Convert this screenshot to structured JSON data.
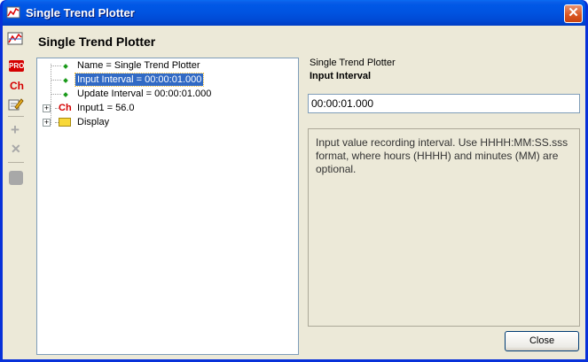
{
  "window": {
    "title": "Single Trend Plotter",
    "close_glyph": "✕"
  },
  "header": {
    "title": "Single Trend Plotter"
  },
  "toolbar": {
    "items": [
      {
        "icon": "trend-plot-icon"
      },
      {
        "icon": "pro-icon",
        "label": "PRO"
      },
      {
        "icon": "channel-icon",
        "label": "Ch"
      },
      {
        "icon": "edit-icon"
      },
      {
        "icon": "add-icon",
        "label": "+"
      },
      {
        "icon": "delete-icon",
        "label": "✕"
      },
      {
        "icon": "stop-icon"
      }
    ]
  },
  "tree": {
    "items": [
      {
        "label": "Name = Single Trend Plotter"
      },
      {
        "label": "Input Interval = 00:00:01.000",
        "selected": true
      },
      {
        "label": "Update Interval = 00:00:01.000"
      },
      {
        "label": "Input1 = 56.0",
        "icon_text": "Ch"
      },
      {
        "label": "Display"
      }
    ],
    "expander_glyph": "+"
  },
  "properties": {
    "context": "Single Trend Plotter",
    "name": "Input Interval",
    "value": "00:00:01.000",
    "description": "Input value recording interval. Use HHHH:MM:SS.sss format, where hours (HHHH) and minutes (MM) are optional."
  },
  "buttons": {
    "close": "Close"
  },
  "colors": {
    "titlebar": "#0053e0",
    "selection": "#316ac5",
    "dialog_bg": "#ece9d8"
  }
}
